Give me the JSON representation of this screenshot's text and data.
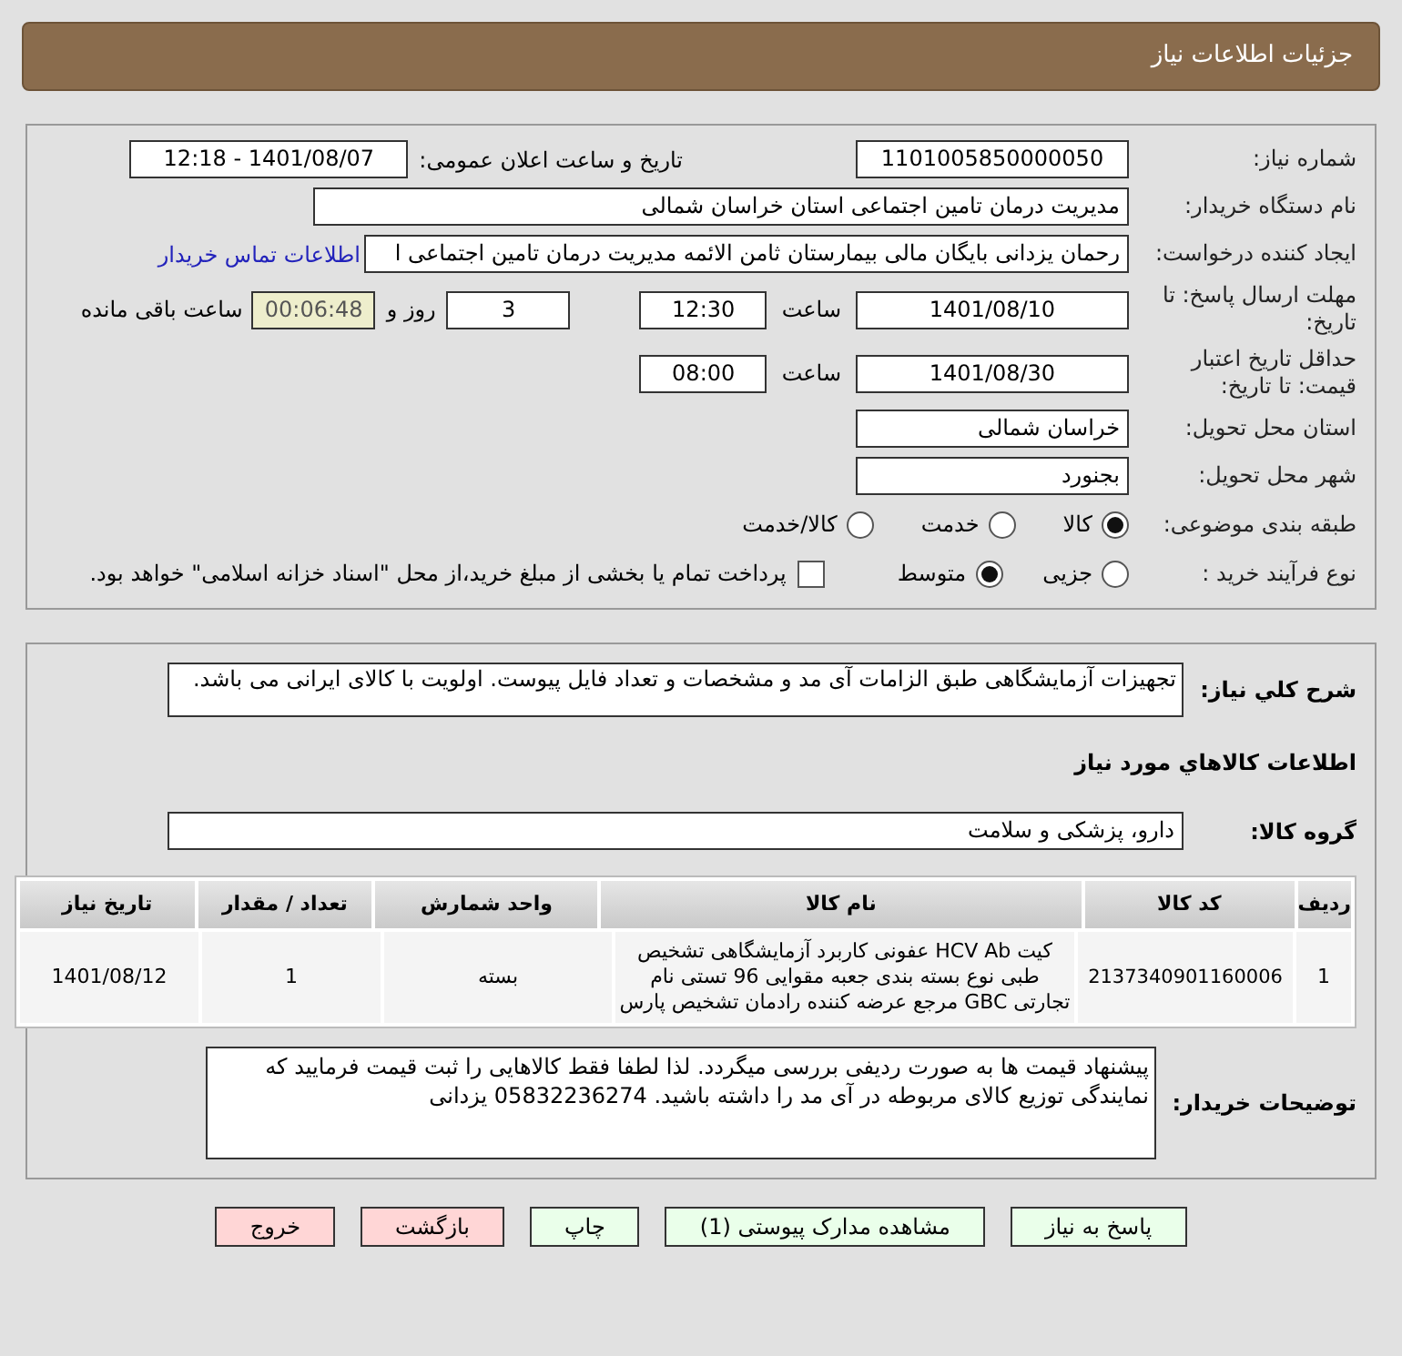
{
  "header": {
    "title": "جزئیات اطلاعات نیاز"
  },
  "form": {
    "request_number": {
      "label": "شماره نیاز:",
      "value": "1101005850000050"
    },
    "announce": {
      "label": "تاریخ و ساعت اعلان عمومی:",
      "value": "1401/08/07 - 12:18"
    },
    "buyer_org": {
      "label": "نام دستگاه خریدار:",
      "value": "مدیریت درمان تامین اجتماعی استان خراسان شمالی"
    },
    "creator": {
      "label": "ایجاد کننده درخواست:",
      "value": "رحمان یزدانی بایگان مالی بیمارستان ثامن الائمه مدیریت درمان تامین اجتماعی ا",
      "link": "اطلاعات تماس خریدار"
    },
    "reply_deadline": {
      "label": "مهلت ارسال پاسخ: تا تاریخ:",
      "date": "1401/08/10",
      "time_label": "ساعت",
      "time": "12:30",
      "days": "3",
      "days_label": "روز و",
      "remaining": "00:06:48",
      "remaining_label": "ساعت باقی مانده"
    },
    "price_validity": {
      "label": "حداقل تاریخ اعتبار قیمت: تا تاریخ:",
      "date": "1401/08/30",
      "time_label": "ساعت",
      "time": "08:00"
    },
    "province": {
      "label": "استان محل تحویل:",
      "value": "خراسان شمالی"
    },
    "city": {
      "label": "شهر محل تحویل:",
      "value": "بجنورد"
    },
    "category": {
      "label": "طبقه بندی موضوعی:",
      "options": [
        {
          "label": "کالا",
          "selected": true
        },
        {
          "label": "خدمت",
          "selected": false
        },
        {
          "label": "کالا/خدمت",
          "selected": false
        }
      ]
    },
    "purchase_type": {
      "label": "نوع فرآیند خرید :",
      "options": [
        {
          "label": "جزیی",
          "selected": false
        },
        {
          "label": "متوسط",
          "selected": true
        }
      ],
      "payment_note": {
        "label": "پرداخت تمام یا بخشی از مبلغ خرید،از محل \"اسناد خزانه اسلامی\" خواهد بود.",
        "checked": false
      }
    }
  },
  "details": {
    "description": {
      "label": "شرح کلي نياز:",
      "value": "تجهیزات آزمایشگاهی طبق الزامات آی مد و مشخصات و تعداد فایل پیوست. اولویت با کالای ایرانی می باشد."
    },
    "goods_heading": "اطلاعات کالاهاي مورد نياز",
    "goods_group": {
      "label": "گروه کالا:",
      "value": "دارو، پزشکی و سلامت"
    },
    "table": {
      "columns": [
        "ردیف",
        "کد کالا",
        "نام کالا",
        "واحد شمارش",
        "تعداد / مقدار",
        "تاریخ نیاز"
      ],
      "rows": [
        [
          "1",
          "2137340901160006",
          "کیت HCV Ab عفونی کاربرد آزمایشگاهی تشخیص طبی نوع بسته بندی جعبه مقوایی 96 تستی نام تجارتی GBC مرجع عرضه کننده رادمان تشخیص پارس",
          "بسته",
          "1",
          "1401/08/12"
        ]
      ]
    },
    "buyer_notes": {
      "label": "توضیحات خریدار:",
      "value": "پیشنهاد قیمت ها به صورت ردیفی بررسی میگردد. لذا لطفا  فقط کالاهایی را ثبت قیمت فرمایید که نمایندگی توزیع کالای مربوطه در آی مد را داشته باشید. 05832236274 یزدانی"
    }
  },
  "buttons": [
    {
      "label": "پاسخ به نیاز",
      "kind": "normal"
    },
    {
      "label": "مشاهده مدارک پیوستی (1)",
      "kind": "normal"
    },
    {
      "label": "چاپ",
      "kind": "normal"
    },
    {
      "label": "بازگشت",
      "kind": "exit"
    },
    {
      "label": "خروج",
      "kind": "exit"
    }
  ]
}
